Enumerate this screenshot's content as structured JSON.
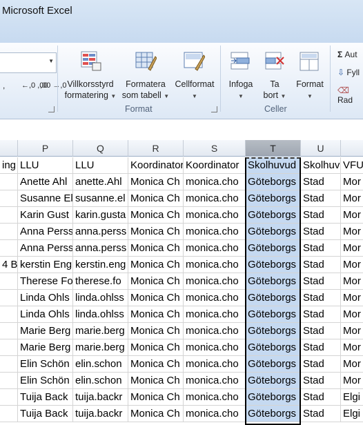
{
  "window": {
    "title": "Microsoft Excel"
  },
  "ribbon": {
    "number_buttons": {
      "comma": ",",
      "inc_decimal": "←,0 ,00",
      "dec_decimal": ",00 →,0"
    },
    "format_group": {
      "label": "Format",
      "conditional": [
        "Villkorsstyrd",
        "formatering"
      ],
      "as_table": [
        "Formatera",
        "som tabell"
      ],
      "cell_styles": [
        "Cellformat",
        ""
      ]
    },
    "cells_group": {
      "label": "Celler",
      "insert": "Infoga",
      "delete": [
        "Ta",
        "bort"
      ],
      "format": "Format"
    },
    "editing_group": {
      "autosum": "Aut",
      "fill": "Fyll",
      "clear": "Rad"
    }
  },
  "columns": [
    {
      "letter": "",
      "selected": false
    },
    {
      "letter": "P",
      "selected": false
    },
    {
      "letter": "Q",
      "selected": false
    },
    {
      "letter": "R",
      "selected": false
    },
    {
      "letter": "S",
      "selected": false
    },
    {
      "letter": "T",
      "selected": true
    },
    {
      "letter": "U",
      "selected": false
    },
    {
      "letter": "",
      "selected": false
    }
  ],
  "rows": [
    [
      "ing",
      "LLU",
      "LLU",
      "Koordinator",
      "Koordinator",
      "Skolhuvud",
      "Skolhuv",
      "VFU"
    ],
    [
      "",
      "Anette Ahl",
      "anette.Ahl",
      "Monica Ch",
      "monica.cho",
      "Göteborgs",
      "Stad",
      "Mor"
    ],
    [
      "",
      "Susanne El",
      "susanne.el",
      "Monica Ch",
      "monica.cho",
      "Göteborgs",
      "Stad",
      "Mor"
    ],
    [
      "",
      "Karin Gust",
      "karin.gusta",
      "Monica Ch",
      "monica.cho",
      "Göteborgs",
      "Stad",
      "Mor"
    ],
    [
      "",
      "Anna Perss",
      "anna.perss",
      "Monica Ch",
      "monica.cho",
      "Göteborgs",
      "Stad",
      "Mor"
    ],
    [
      "",
      "Anna Perss",
      "anna.perss",
      "Monica Ch",
      "monica.cho",
      "Göteborgs",
      "Stad",
      "Mor"
    ],
    [
      "4 B",
      "kerstin Eng",
      "kerstin.eng",
      "Monica Ch",
      "monica.cho",
      "Göteborgs",
      "Stad",
      "Mor"
    ],
    [
      "",
      "Therese Fo",
      "therese.fo",
      "Monica Ch",
      "monica.cho",
      "Göteborgs",
      "Stad",
      "Mor"
    ],
    [
      "",
      "Linda Ohls",
      "linda.ohlss",
      "Monica Ch",
      "monica.cho",
      "Göteborgs",
      "Stad",
      "Mor"
    ],
    [
      "",
      "Linda Ohls",
      "linda.ohlss",
      "Monica Ch",
      "monica.cho",
      "Göteborgs",
      "Stad",
      "Mor"
    ],
    [
      "",
      "Marie Berg",
      "marie.berg",
      "Monica Ch",
      "monica.cho",
      "Göteborgs",
      "Stad",
      "Mor"
    ],
    [
      "",
      "Marie Berg",
      "marie.berg",
      "Monica Ch",
      "monica.cho",
      "Göteborgs",
      "Stad",
      "Mor"
    ],
    [
      "",
      "Elin Schön",
      "elin.schon",
      "Monica Ch",
      "monica.cho",
      "Göteborgs",
      "Stad",
      "Mor"
    ],
    [
      "",
      "Elin Schön",
      "elin.schon",
      "Monica Ch",
      "monica.cho",
      "Göteborgs",
      "Stad",
      "Mor"
    ],
    [
      "",
      "Tuija Back",
      "tuija.backr",
      "Monica Ch",
      "monica.cho",
      "Göteborgs",
      "Stad",
      "Elgi"
    ],
    [
      "",
      "Tuija Back",
      "tuija.backr",
      "Monica Ch",
      "monica.cho",
      "Göteborgs",
      "Stad",
      "Elgi"
    ]
  ]
}
